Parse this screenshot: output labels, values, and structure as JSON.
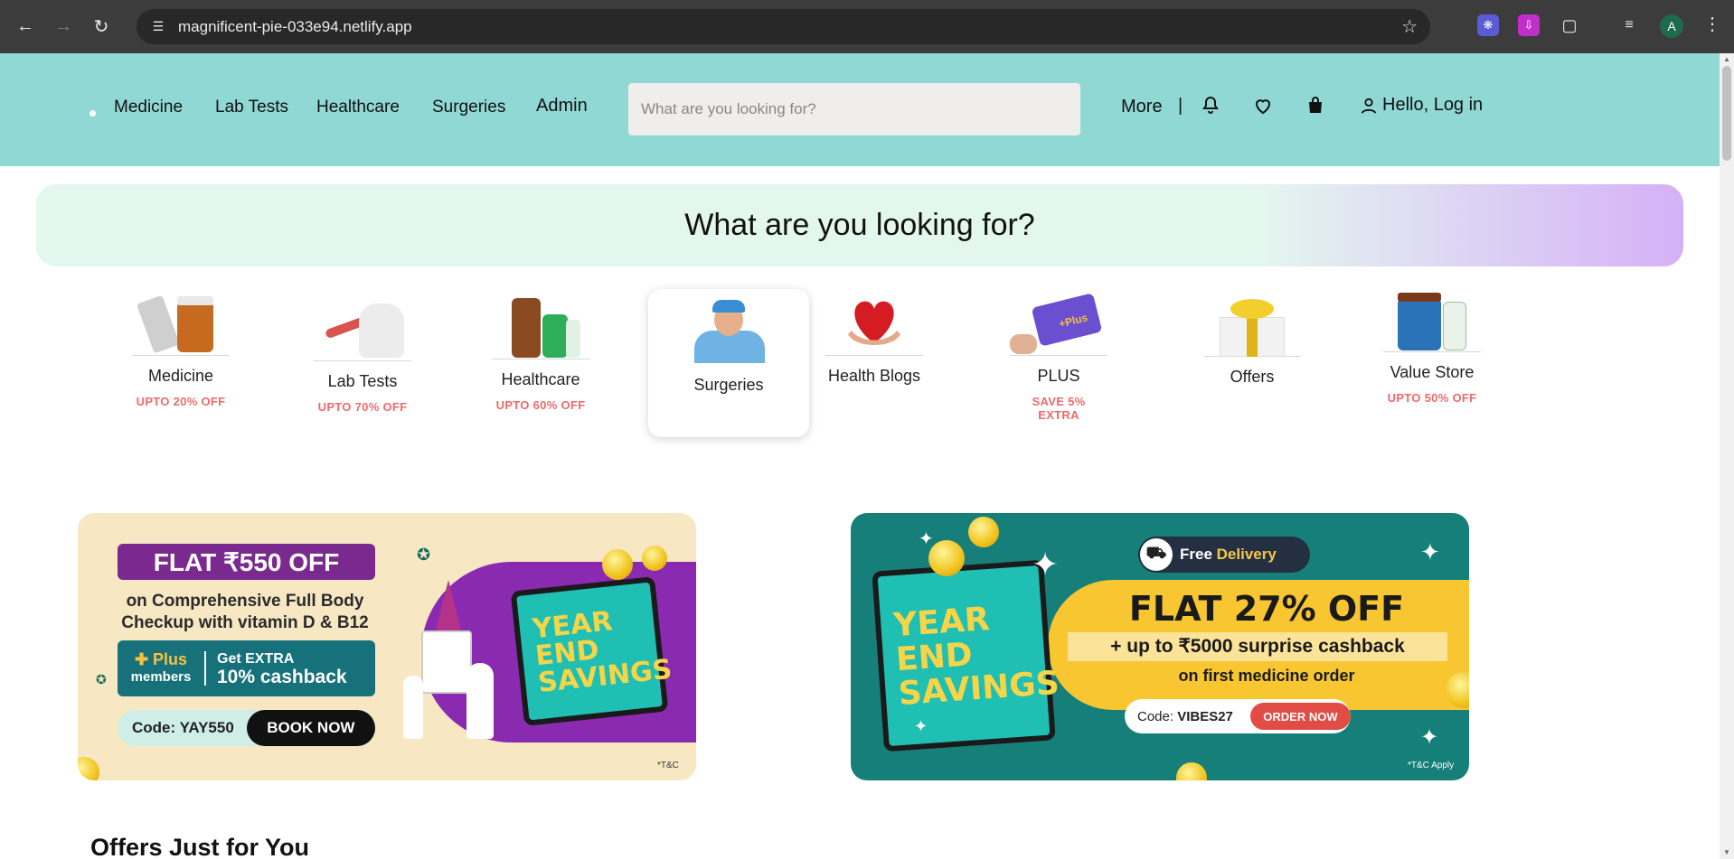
{
  "browser": {
    "url": "magnificent-pie-033e94.netlify.app",
    "avatar_letter": "A"
  },
  "header": {
    "nav": [
      "Medicine",
      "Lab Tests",
      "Healthcare",
      "Surgeries",
      "Admin"
    ],
    "search_placeholder": "What are you looking for?",
    "more": "More",
    "separator": "|",
    "login": "Hello, Log in"
  },
  "looking": {
    "title": "What are you looking for?"
  },
  "categories": [
    {
      "name": "Medicine",
      "offer": "UPTO 20% OFF"
    },
    {
      "name": "Lab Tests",
      "offer": "UPTO 70% OFF"
    },
    {
      "name": "Healthcare",
      "offer": "UPTO 60% OFF"
    },
    {
      "name": "Surgeries",
      "offer": ""
    },
    {
      "name": "Health Blogs",
      "offer": ""
    },
    {
      "name": "PLUS",
      "offer": "SAVE 5% EXTRA"
    },
    {
      "name": "Offers",
      "offer": ""
    },
    {
      "name": "Value Store",
      "offer": "UPTO 50% OFF"
    }
  ],
  "promo1": {
    "headline": "FLAT ₹550 OFF",
    "line1": "on Comprehensive Full Body",
    "line2": "Checkup with vitamin D & B12",
    "plus": "Plus",
    "members": "members",
    "extra1": "Get EXTRA",
    "extra2": "10% cashback",
    "code": "Code: YAY550",
    "cta": "BOOK NOW",
    "calendar": "YEAR END SAVINGS",
    "tnc": "*T&C"
  },
  "promo2": {
    "free": "Free",
    "delivery": "Delivery",
    "headline": "FLAT 27% OFF",
    "cashback": "+ up to ₹5000 surprise cashback",
    "first": "on first medicine order",
    "code_label": "Code:",
    "code": "VIBES27",
    "cta": "ORDER NOW",
    "calendar": "YEAR END SAVINGS",
    "tnc": "*T&C Apply"
  },
  "offers_title": "Offers Just for You",
  "colors": {
    "header_bg": "#90d8d4",
    "offer_red": "#ee6a6a",
    "promo_purple": "#7a2a8f",
    "promo_teal": "#167f7a"
  }
}
